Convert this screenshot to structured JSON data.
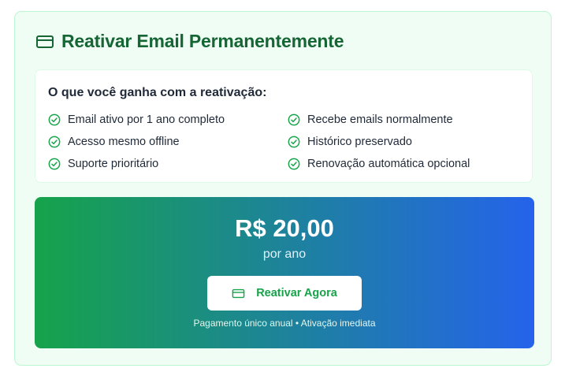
{
  "header": {
    "title": "Reativar Email Permanentemente",
    "icon": "credit-card-icon"
  },
  "benefits": {
    "title": "O que você ganha com a reativação:",
    "items": [
      {
        "label": "Email ativo por 1 ano completo",
        "icon": "check-circle-icon"
      },
      {
        "label": "Recebe emails normalmente",
        "icon": "check-circle-icon"
      },
      {
        "label": "Acesso mesmo offline",
        "icon": "check-circle-icon"
      },
      {
        "label": "Histórico preservado",
        "icon": "check-circle-icon"
      },
      {
        "label": "Suporte prioritário",
        "icon": "check-circle-icon"
      },
      {
        "label": "Renovação automática opcional",
        "icon": "check-circle-icon"
      }
    ]
  },
  "pricing": {
    "price": "R$ 20,00",
    "period": "por ano",
    "cta_label": "Reativar Agora",
    "footnote": "Pagamento único anual • Ativação imediata"
  },
  "colors": {
    "brand_green": "#16a34a",
    "title_green": "#166534",
    "gradient_start": "#16a34a",
    "gradient_end": "#2563eb",
    "card_bg": "#f0fdf4"
  }
}
